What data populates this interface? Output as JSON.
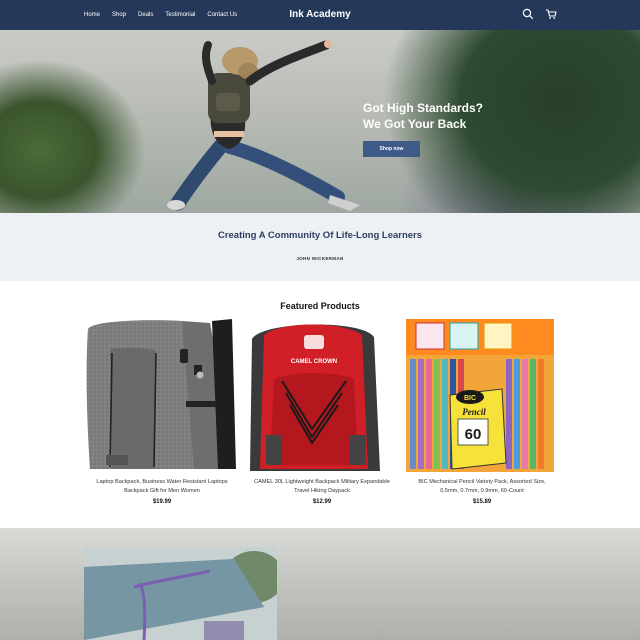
{
  "header": {
    "nav": [
      "Home",
      "Shop",
      "Deals",
      "Testimonial",
      "Contact Us"
    ],
    "brand": "Ink Academy",
    "icons": [
      "search-icon",
      "cart-icon"
    ]
  },
  "hero": {
    "headline_line1": "Got High Standards?",
    "headline_line2": "We Got Your Back",
    "cta_label": "Shop now"
  },
  "quote": {
    "text": "Creating A Community Of Life-Long Learners",
    "author": "JOHN WICKERMAN"
  },
  "featured": {
    "title": "Featured Products",
    "products": [
      {
        "title_line1": "Laptop Backpack, Business Water Resistant Laptops",
        "title_line2": "Backpack Gift for Men Women",
        "price": "$19.99"
      },
      {
        "title_line1": "CAMEL 30L Lightweight Backpack Military Expandable",
        "title_line2": "Travel Hiking Daypack",
        "price": "$12.99",
        "image_brand": "CAMEL CROWN"
      },
      {
        "title_line1": "BIC Mechanical Pencil Variety Pack, Assorted Size,",
        "title_line2": "0.5mm, 0.7mm, 0.9mm, 60-Count",
        "price": "$15.89",
        "image_brand": "BIC",
        "image_label": "Pencil",
        "image_count": "60"
      }
    ]
  },
  "colors": {
    "header_bg": "#25385a",
    "accent": "#3e5a86",
    "quote_bg": "#edf1f5"
  }
}
